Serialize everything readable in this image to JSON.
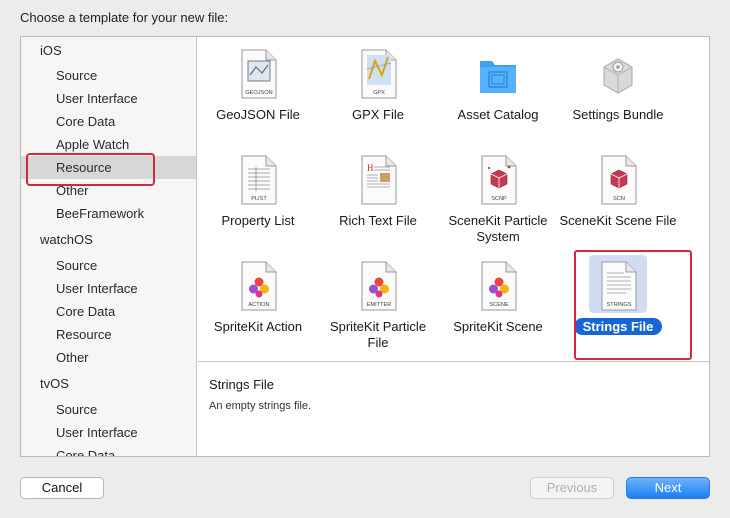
{
  "dialog": {
    "heading": "Choose a template for your new file:"
  },
  "sidebar": {
    "rows": [
      {
        "label": "iOS",
        "kind": "platform"
      },
      {
        "label": "Source",
        "kind": "child"
      },
      {
        "label": "User Interface",
        "kind": "child"
      },
      {
        "label": "Core Data",
        "kind": "child"
      },
      {
        "label": "Apple Watch",
        "kind": "child"
      },
      {
        "label": "Resource",
        "kind": "child",
        "selected": true
      },
      {
        "label": "Other",
        "kind": "child"
      },
      {
        "label": "BeeFramework",
        "kind": "child"
      },
      {
        "label": "watchOS",
        "kind": "platform"
      },
      {
        "label": "Source",
        "kind": "child"
      },
      {
        "label": "User Interface",
        "kind": "child"
      },
      {
        "label": "Core Data",
        "kind": "child"
      },
      {
        "label": "Resource",
        "kind": "child"
      },
      {
        "label": "Other",
        "kind": "child"
      },
      {
        "label": "tvOS",
        "kind": "platform"
      },
      {
        "label": "Source",
        "kind": "child"
      },
      {
        "label": "User Interface",
        "kind": "child"
      },
      {
        "label": "Core Data",
        "kind": "child"
      }
    ]
  },
  "templates": [
    {
      "label": "GeoJSON File",
      "icon": "geojson-icon",
      "tag": "GEOJSON"
    },
    {
      "label": "GPX File",
      "icon": "gpx-icon",
      "tag": "GPX"
    },
    {
      "label": "Asset Catalog",
      "icon": "folder-icon",
      "tag": ""
    },
    {
      "label": "Settings Bundle",
      "icon": "bundle-icon",
      "tag": ""
    },
    {
      "label": "Property List",
      "icon": "plist-icon",
      "tag": "PLIST"
    },
    {
      "label": "Rich Text File",
      "icon": "rich-text-icon",
      "tag": ""
    },
    {
      "label": "SceneKit Particle System",
      "icon": "scenekit-particle-icon",
      "tag": "SCNP"
    },
    {
      "label": "SceneKit Scene File",
      "icon": "scenekit-scene-icon",
      "tag": "SCN"
    },
    {
      "label": "SpriteKit Action",
      "icon": "spritekit-action-icon",
      "tag": "ACTION"
    },
    {
      "label": "SpriteKit Particle File",
      "icon": "spritekit-particle-icon",
      "tag": "EMITTER"
    },
    {
      "label": "SpriteKit Scene",
      "icon": "spritekit-scene-icon",
      "tag": "SCENE"
    },
    {
      "label": "Strings File",
      "icon": "strings-icon",
      "tag": "STRINGS",
      "selected": true
    }
  ],
  "description": {
    "title": "Strings File",
    "text": "An empty strings file."
  },
  "buttons": {
    "cancel": "Cancel",
    "previous": "Previous",
    "next": "Next"
  },
  "colors": {
    "accent": "#1766d7",
    "highlight_box": "#d8263c",
    "sidebar_selected": "#d7d7d7"
  }
}
